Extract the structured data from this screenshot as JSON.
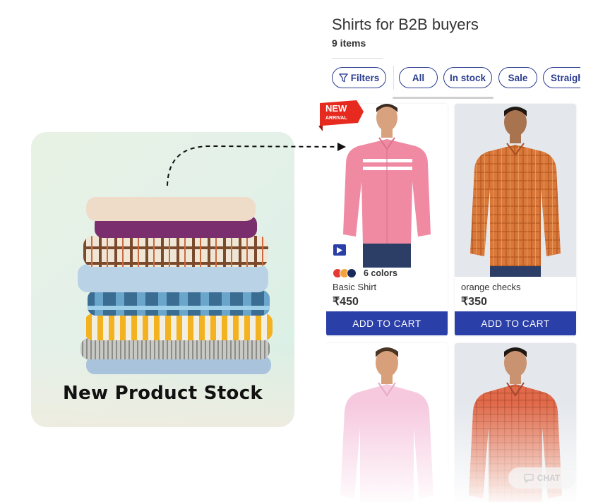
{
  "promo": {
    "title": "New Product Stock"
  },
  "panel": {
    "title": "Shirts for B2B buyers",
    "count": "9 items",
    "filters_label": "Filters",
    "chips": [
      "All",
      "In stock",
      "Sale",
      "Straight"
    ]
  },
  "products": [
    {
      "badge_line1": "NEW",
      "badge_line2": "ARRIVAL",
      "colors_label": "6 colors",
      "swatches": [
        "#e53935",
        "#f4a23a",
        "#1a2a5e"
      ],
      "name": "Basic Shirt",
      "price": "₹450",
      "button": "ADD TO CART",
      "shirt_color": "#f08aa2"
    },
    {
      "name": "orange checks",
      "price": "₹350",
      "button": "ADD TO CART",
      "shirt_color": "#d9783a"
    },
    {
      "shirt_color": "#f6c9df"
    },
    {
      "shirt_color": "#e06a4a"
    }
  ],
  "chat": {
    "label": "CHAT"
  },
  "colors": {
    "accent": "#2b3fa8",
    "chip_border": "#2b3d8f",
    "badge_red": "#e62a1f"
  }
}
